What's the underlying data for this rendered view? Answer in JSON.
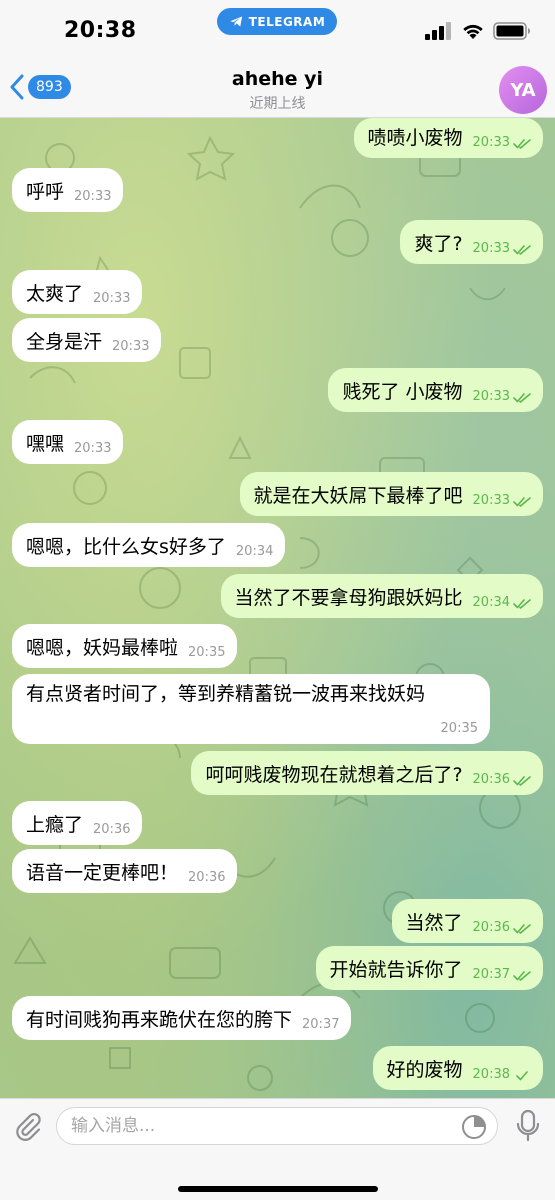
{
  "status_bar": {
    "time": "20:38",
    "pill_label": "TELEGRAM"
  },
  "header": {
    "back_count": "893",
    "title": "ahehe yi",
    "subtitle": "近期上线",
    "avatar_initials": "YA"
  },
  "messages": [
    {
      "dir": "out",
      "text": "啧啧小废物",
      "time": "20:33",
      "status": "read"
    },
    {
      "dir": "in",
      "text": "呼呼",
      "time": "20:33"
    },
    {
      "dir": "out",
      "text": "爽了?",
      "time": "20:33",
      "status": "read"
    },
    {
      "dir": "in",
      "text": "太爽了",
      "time": "20:33"
    },
    {
      "dir": "in",
      "text": "全身是汗",
      "time": "20:33"
    },
    {
      "dir": "out",
      "text": "贱死了 小废物",
      "time": "20:33",
      "status": "read"
    },
    {
      "dir": "in",
      "text": "嘿嘿",
      "time": "20:33"
    },
    {
      "dir": "out",
      "text": "就是在大妖屌下最棒了吧",
      "time": "20:33",
      "status": "read"
    },
    {
      "dir": "in",
      "text": "嗯嗯，比什么女s好多了",
      "time": "20:34"
    },
    {
      "dir": "out",
      "text": "当然了不要拿母狗跟妖妈比",
      "time": "20:34",
      "status": "read"
    },
    {
      "dir": "in",
      "text": "嗯嗯，妖妈最棒啦",
      "time": "20:35"
    },
    {
      "dir": "in",
      "text": "有点贤者时间了，等到养精蓄锐一波再来找妖妈",
      "time": "20:35"
    },
    {
      "dir": "out",
      "text": "呵呵贱废物现在就想着之后了?",
      "time": "20:36",
      "status": "read"
    },
    {
      "dir": "in",
      "text": "上瘾了",
      "time": "20:36"
    },
    {
      "dir": "in",
      "text": "语音一定更棒吧！",
      "time": "20:36"
    },
    {
      "dir": "out",
      "text": "当然了",
      "time": "20:36",
      "status": "read"
    },
    {
      "dir": "out",
      "text": "开始就告诉你了",
      "time": "20:37",
      "status": "read"
    },
    {
      "dir": "in",
      "text": "有时间贱狗再来跪伏在您的胯下",
      "time": "20:37"
    },
    {
      "dir": "out",
      "text": "好的废物",
      "time": "20:38",
      "status": "sent"
    }
  ],
  "input": {
    "placeholder": "输入消息..."
  },
  "colors": {
    "accent": "#2f8ae6",
    "outgoing_bubble": "#e3fcc7",
    "incoming_bubble": "#ffffff",
    "read_check": "#5ab74f"
  },
  "icons": [
    "telegram-icon",
    "signal-icon",
    "wifi-icon",
    "battery-icon",
    "chevron-left-icon",
    "paperclip-icon",
    "sticker-icon",
    "microphone-icon",
    "double-check-icon",
    "single-check-icon"
  ]
}
